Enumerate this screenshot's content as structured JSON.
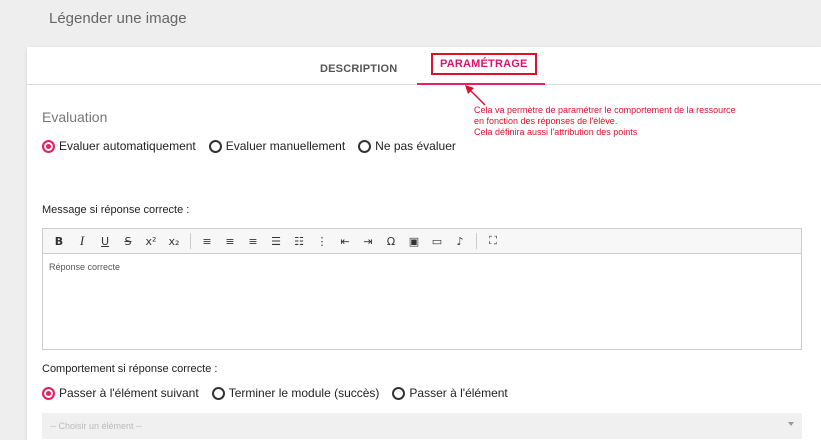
{
  "page": {
    "title": "Légender une image"
  },
  "tabs": [
    {
      "label": "DESCRIPTION"
    },
    {
      "label": "PARAMÉTRAGE"
    }
  ],
  "annotation": {
    "text": "Cela va permètre de paramétrer le comportement de la ressource\nen fonction des réponses de l'élève.\nCela définira aussi l'attribution des points",
    "color": "#e0102c"
  },
  "evaluation": {
    "title": "Evaluation",
    "options": [
      {
        "label": "Evaluer automatiquement",
        "selected": true
      },
      {
        "label": "Evaluer manuellement",
        "selected": false
      },
      {
        "label": "Ne pas évaluer",
        "selected": false
      }
    ]
  },
  "message": {
    "label": "Message si réponse correcte :",
    "content": "Réponse correcte"
  },
  "toolbar_icons": [
    "bold-icon",
    "italic-icon",
    "underline-icon",
    "strikethrough-icon",
    "superscript-icon",
    "subscript-icon",
    "align-left-icon",
    "align-center-icon",
    "align-right-icon",
    "align-justify-icon",
    "bullet-list-icon",
    "numbered-list-icon",
    "outdent-icon",
    "indent-icon",
    "special-char-icon",
    "image-icon",
    "media-icon",
    "audio-icon",
    "fullscreen-icon"
  ],
  "behavior": {
    "label": "Comportement si réponse correcte :",
    "options": [
      {
        "label": "Passer à l'élément suivant",
        "selected": true
      },
      {
        "label": "Terminer le module (succès)",
        "selected": false
      },
      {
        "label": "Passer à l'élément",
        "selected": false
      }
    ]
  },
  "element_select": {
    "placeholder": "-- Choisir un élément --"
  },
  "colors": {
    "accent": "#e91e63",
    "annotation": "#e0102c"
  }
}
